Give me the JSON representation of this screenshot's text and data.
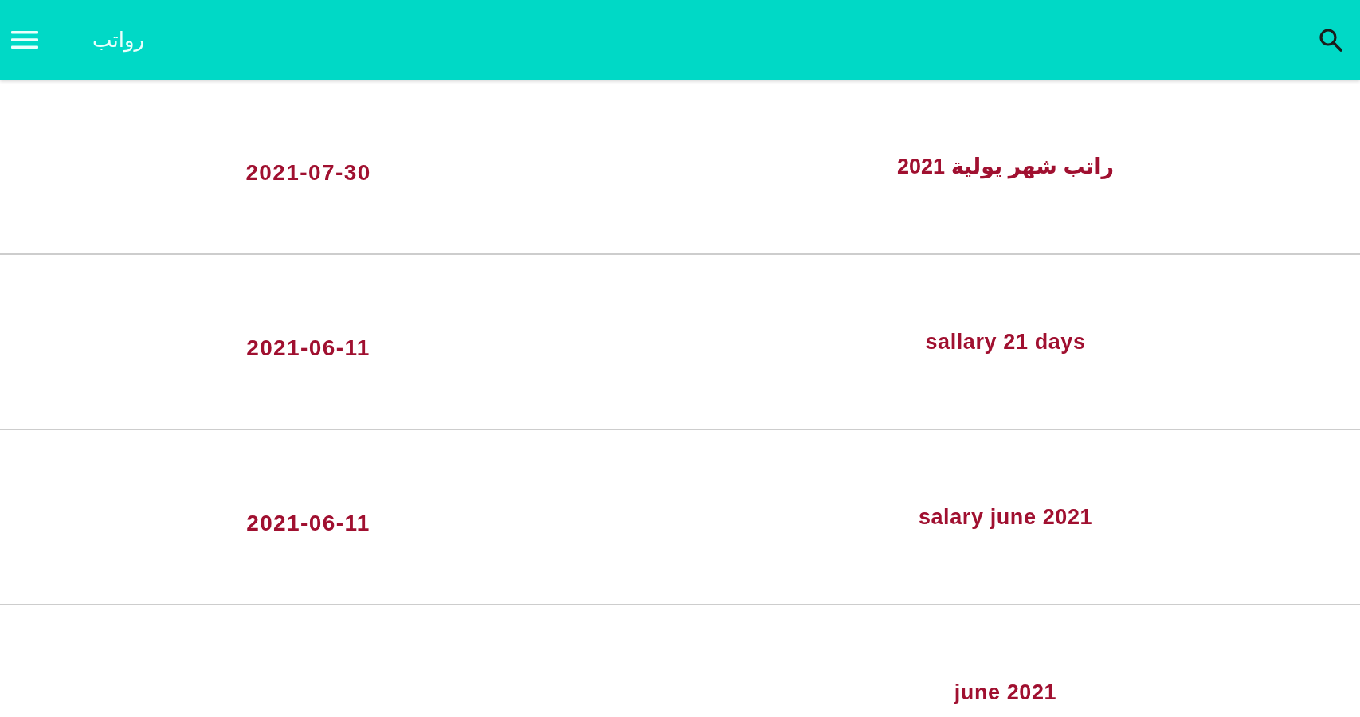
{
  "app_bar": {
    "title": "رواتب"
  },
  "salaries": [
    {
      "title": "راتب شهر يولية 2021",
      "date": "2021-07-30"
    },
    {
      "title": "sallary 21 days",
      "date": "2021-06-11"
    },
    {
      "title": "salary june 2021",
      "date": "2021-06-11"
    },
    {
      "title": "june 2021"
    }
  ]
}
